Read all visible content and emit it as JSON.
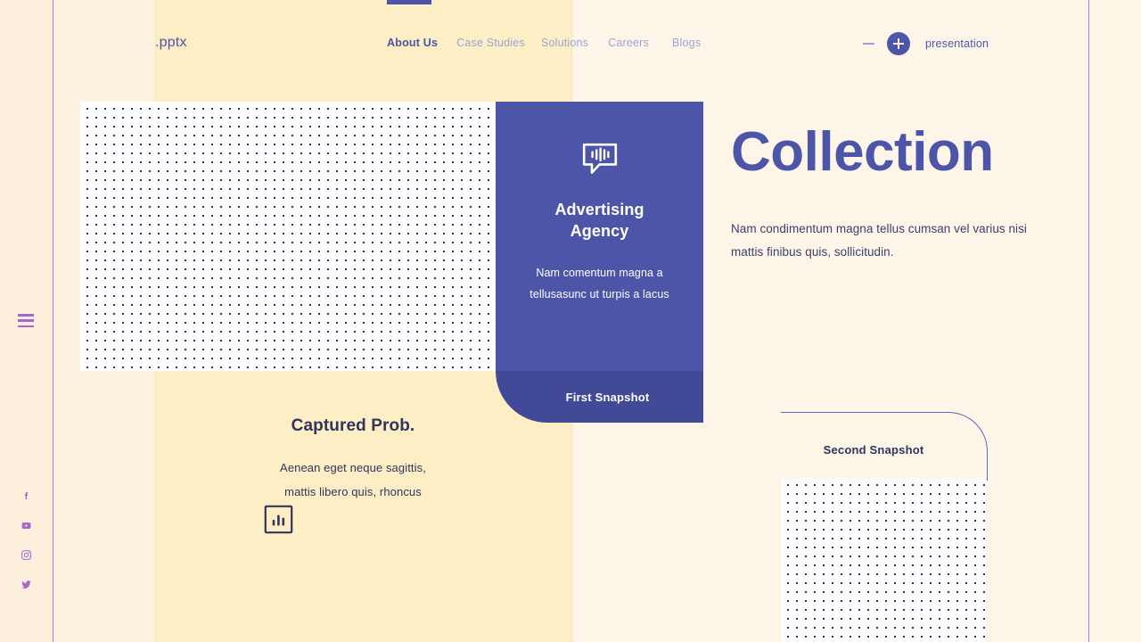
{
  "header": {
    "brand": ".pptx",
    "nav": [
      {
        "label": "About Us",
        "active": true
      },
      {
        "label": "Case Studies",
        "active": false
      },
      {
        "label": "Solutions",
        "active": false
      },
      {
        "label": "Careers",
        "active": false
      },
      {
        "label": "Blogs",
        "active": false
      }
    ],
    "minus_icon": "minus-icon",
    "plus_icon": "plus-icon",
    "presentation_label": "presentation"
  },
  "rail": {
    "menu_icon": "hamburger-menu-icon",
    "socials": [
      {
        "name": "facebook-icon"
      },
      {
        "name": "youtube-icon"
      },
      {
        "name": "instagram-icon"
      },
      {
        "name": "twitter-icon"
      }
    ]
  },
  "card": {
    "icon": "speech-bubble-waveform-icon",
    "title": "Advertising Agency",
    "description": "Nam comentum magna a tellusasunc ut turpis a lacus",
    "footer_label": "First Snapshot"
  },
  "hero": {
    "title": "Collection",
    "description": "Nam condimentum magna tellus cumsan vel varius nisi mattis finibus quis, sollicitudin."
  },
  "feature": {
    "title": "Captured Prob.",
    "description": "Aenean eget neque sagittis, mattis libero quis, rhoncus",
    "icon": "bar-chart-icon"
  },
  "snapshot2": {
    "label": "Second Snapshot"
  },
  "colors": {
    "accent_blue": "#4c55a8",
    "card_footer_blue": "#414a96",
    "purple_line": "#a567cf",
    "background_cream": "#fdeec6",
    "dot_navy": "#2e3060",
    "nav_muted": "#9ea3d6"
  }
}
